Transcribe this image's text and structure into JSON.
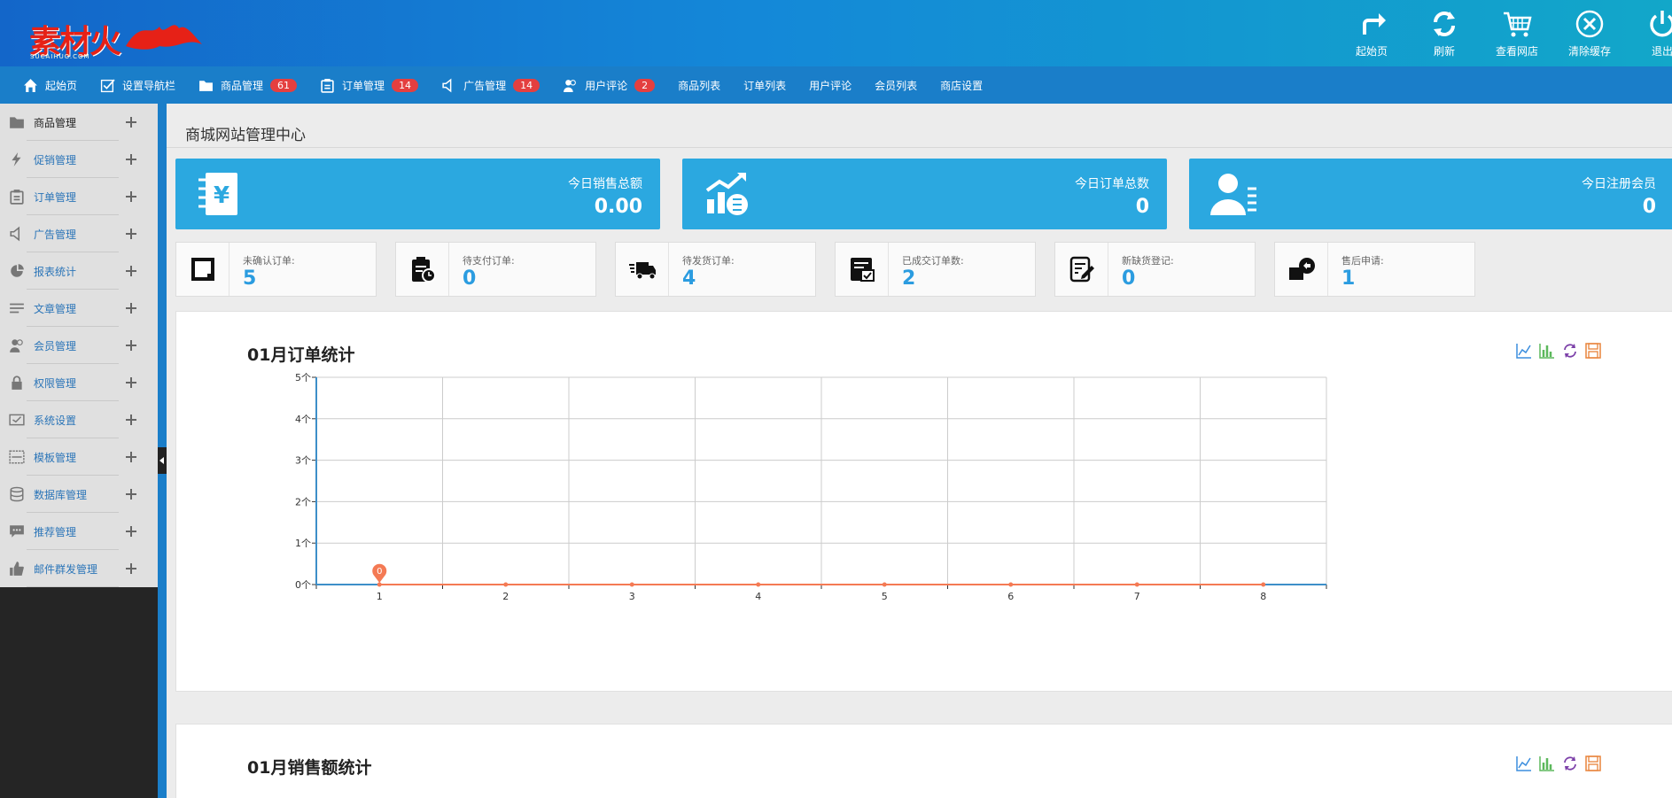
{
  "logo": {
    "text": "素材火",
    "sub": "SUCAIHUO.COM"
  },
  "toolbar": [
    {
      "label": "起始页",
      "icon": "redirect-arrow-icon"
    },
    {
      "label": "刷新",
      "icon": "refresh-icon"
    },
    {
      "label": "查看网店",
      "icon": "cart-icon"
    },
    {
      "label": "清除缓存",
      "icon": "close-circle-icon"
    },
    {
      "label": "退出",
      "icon": "power-icon"
    }
  ],
  "nav": [
    {
      "label": "起始页",
      "icon": "home-icon"
    },
    {
      "label": "设置导航栏",
      "icon": "checkbox-icon"
    },
    {
      "label": "商品管理",
      "icon": "folder-icon",
      "badge": "61"
    },
    {
      "label": "订单管理",
      "icon": "clipboard-icon",
      "badge": "14"
    },
    {
      "label": "广告管理",
      "icon": "speaker-icon",
      "badge": "14"
    },
    {
      "label": "用户评论",
      "icon": "users-icon",
      "badge": "2"
    },
    {
      "label": "商品列表"
    },
    {
      "label": "订单列表"
    },
    {
      "label": "用户评论"
    },
    {
      "label": "会员列表"
    },
    {
      "label": "商店设置"
    }
  ],
  "sidebar": [
    {
      "label": "商品管理",
      "icon": "folder-icon"
    },
    {
      "label": "促销管理",
      "icon": "lightning-icon"
    },
    {
      "label": "订单管理",
      "icon": "clipboard-icon"
    },
    {
      "label": "广告管理",
      "icon": "speaker-icon"
    },
    {
      "label": "报表统计",
      "icon": "pie-chart-icon"
    },
    {
      "label": "文章管理",
      "icon": "lines-icon"
    },
    {
      "label": "会员管理",
      "icon": "users-icon"
    },
    {
      "label": "权限管理",
      "icon": "lock-icon"
    },
    {
      "label": "系统设置",
      "icon": "monitor-check-icon"
    },
    {
      "label": "模板管理",
      "icon": "template-icon"
    },
    {
      "label": "数据库管理",
      "icon": "database-icon"
    },
    {
      "label": "推荐管理",
      "icon": "chat-icon"
    },
    {
      "label": "邮件群发管理",
      "icon": "thumbs-up-icon"
    }
  ],
  "page_title": "商城网站管理中心",
  "stats": [
    {
      "label": "今日销售总额",
      "value": "0.00",
      "icon": "yen-notebook-icon"
    },
    {
      "label": "今日订单总数",
      "value": "0",
      "icon": "growth-chart-icon"
    },
    {
      "label": "今日注册会员",
      "value": "0",
      "icon": "user-list-icon"
    }
  ],
  "mini_stats": [
    {
      "label": "未确认订单:",
      "value": "5",
      "icon": "square-frame-icon"
    },
    {
      "label": "待支付订单:",
      "value": "0",
      "icon": "clipboard-clock-icon"
    },
    {
      "label": "待发货订单:",
      "value": "4",
      "icon": "truck-icon"
    },
    {
      "label": "已成交订单数:",
      "value": "2",
      "icon": "check-document-icon"
    },
    {
      "label": "新缺货登记:",
      "value": "0",
      "icon": "edit-document-icon"
    },
    {
      "label": "售后申请:",
      "value": "1",
      "icon": "return-box-icon"
    }
  ],
  "panels": {
    "order_title": "01月订单统计",
    "sales_title": "01月销售额统计",
    "tools": [
      "line-chart-icon",
      "bar-chart-icon",
      "restore-icon",
      "save-icon"
    ]
  },
  "colors": {
    "header": "#1488d8",
    "nav": "#1a7ec9",
    "card": "#2ba8e0",
    "accent_value": "#2b9ce0",
    "badge": "#e43f3f",
    "series": "#f47a54",
    "axis": "#3d8fc9"
  },
  "chart_data": {
    "type": "line",
    "x": [
      1,
      2,
      3,
      4,
      5,
      6,
      7,
      8
    ],
    "series": [
      {
        "values": [
          0,
          0,
          0,
          0,
          0,
          0,
          0,
          0
        ]
      }
    ],
    "ylim": [
      0,
      5
    ],
    "yticks": [
      0,
      1,
      2,
      3,
      4,
      5
    ],
    "ytick_suffix": "个",
    "annotations": [
      {
        "x": 1,
        "y": 0,
        "text": "0"
      }
    ],
    "grid": true
  }
}
